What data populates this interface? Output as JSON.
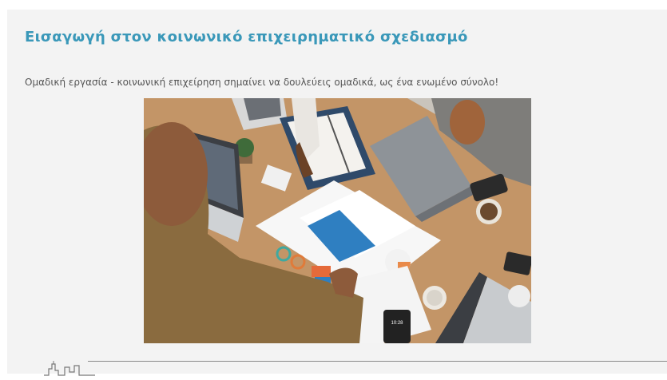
{
  "slide": {
    "title": "Εισαγωγή στον κοινωνικό επιχειρηματικό σχεδιασμό",
    "subtitle": "Ομαδική εργασία - κοινωνική επιχείρηση σημαίνει να δουλεύεις ομαδικά, ως ένα ενωμένο σύνολο!",
    "photo_phone_time": "10:28"
  },
  "footer": {
    "logo_icon": "city-skyline-icon"
  },
  "colors": {
    "title": "#3a98b9",
    "slide_background": "#f3f3f3",
    "table": "#c89968"
  }
}
